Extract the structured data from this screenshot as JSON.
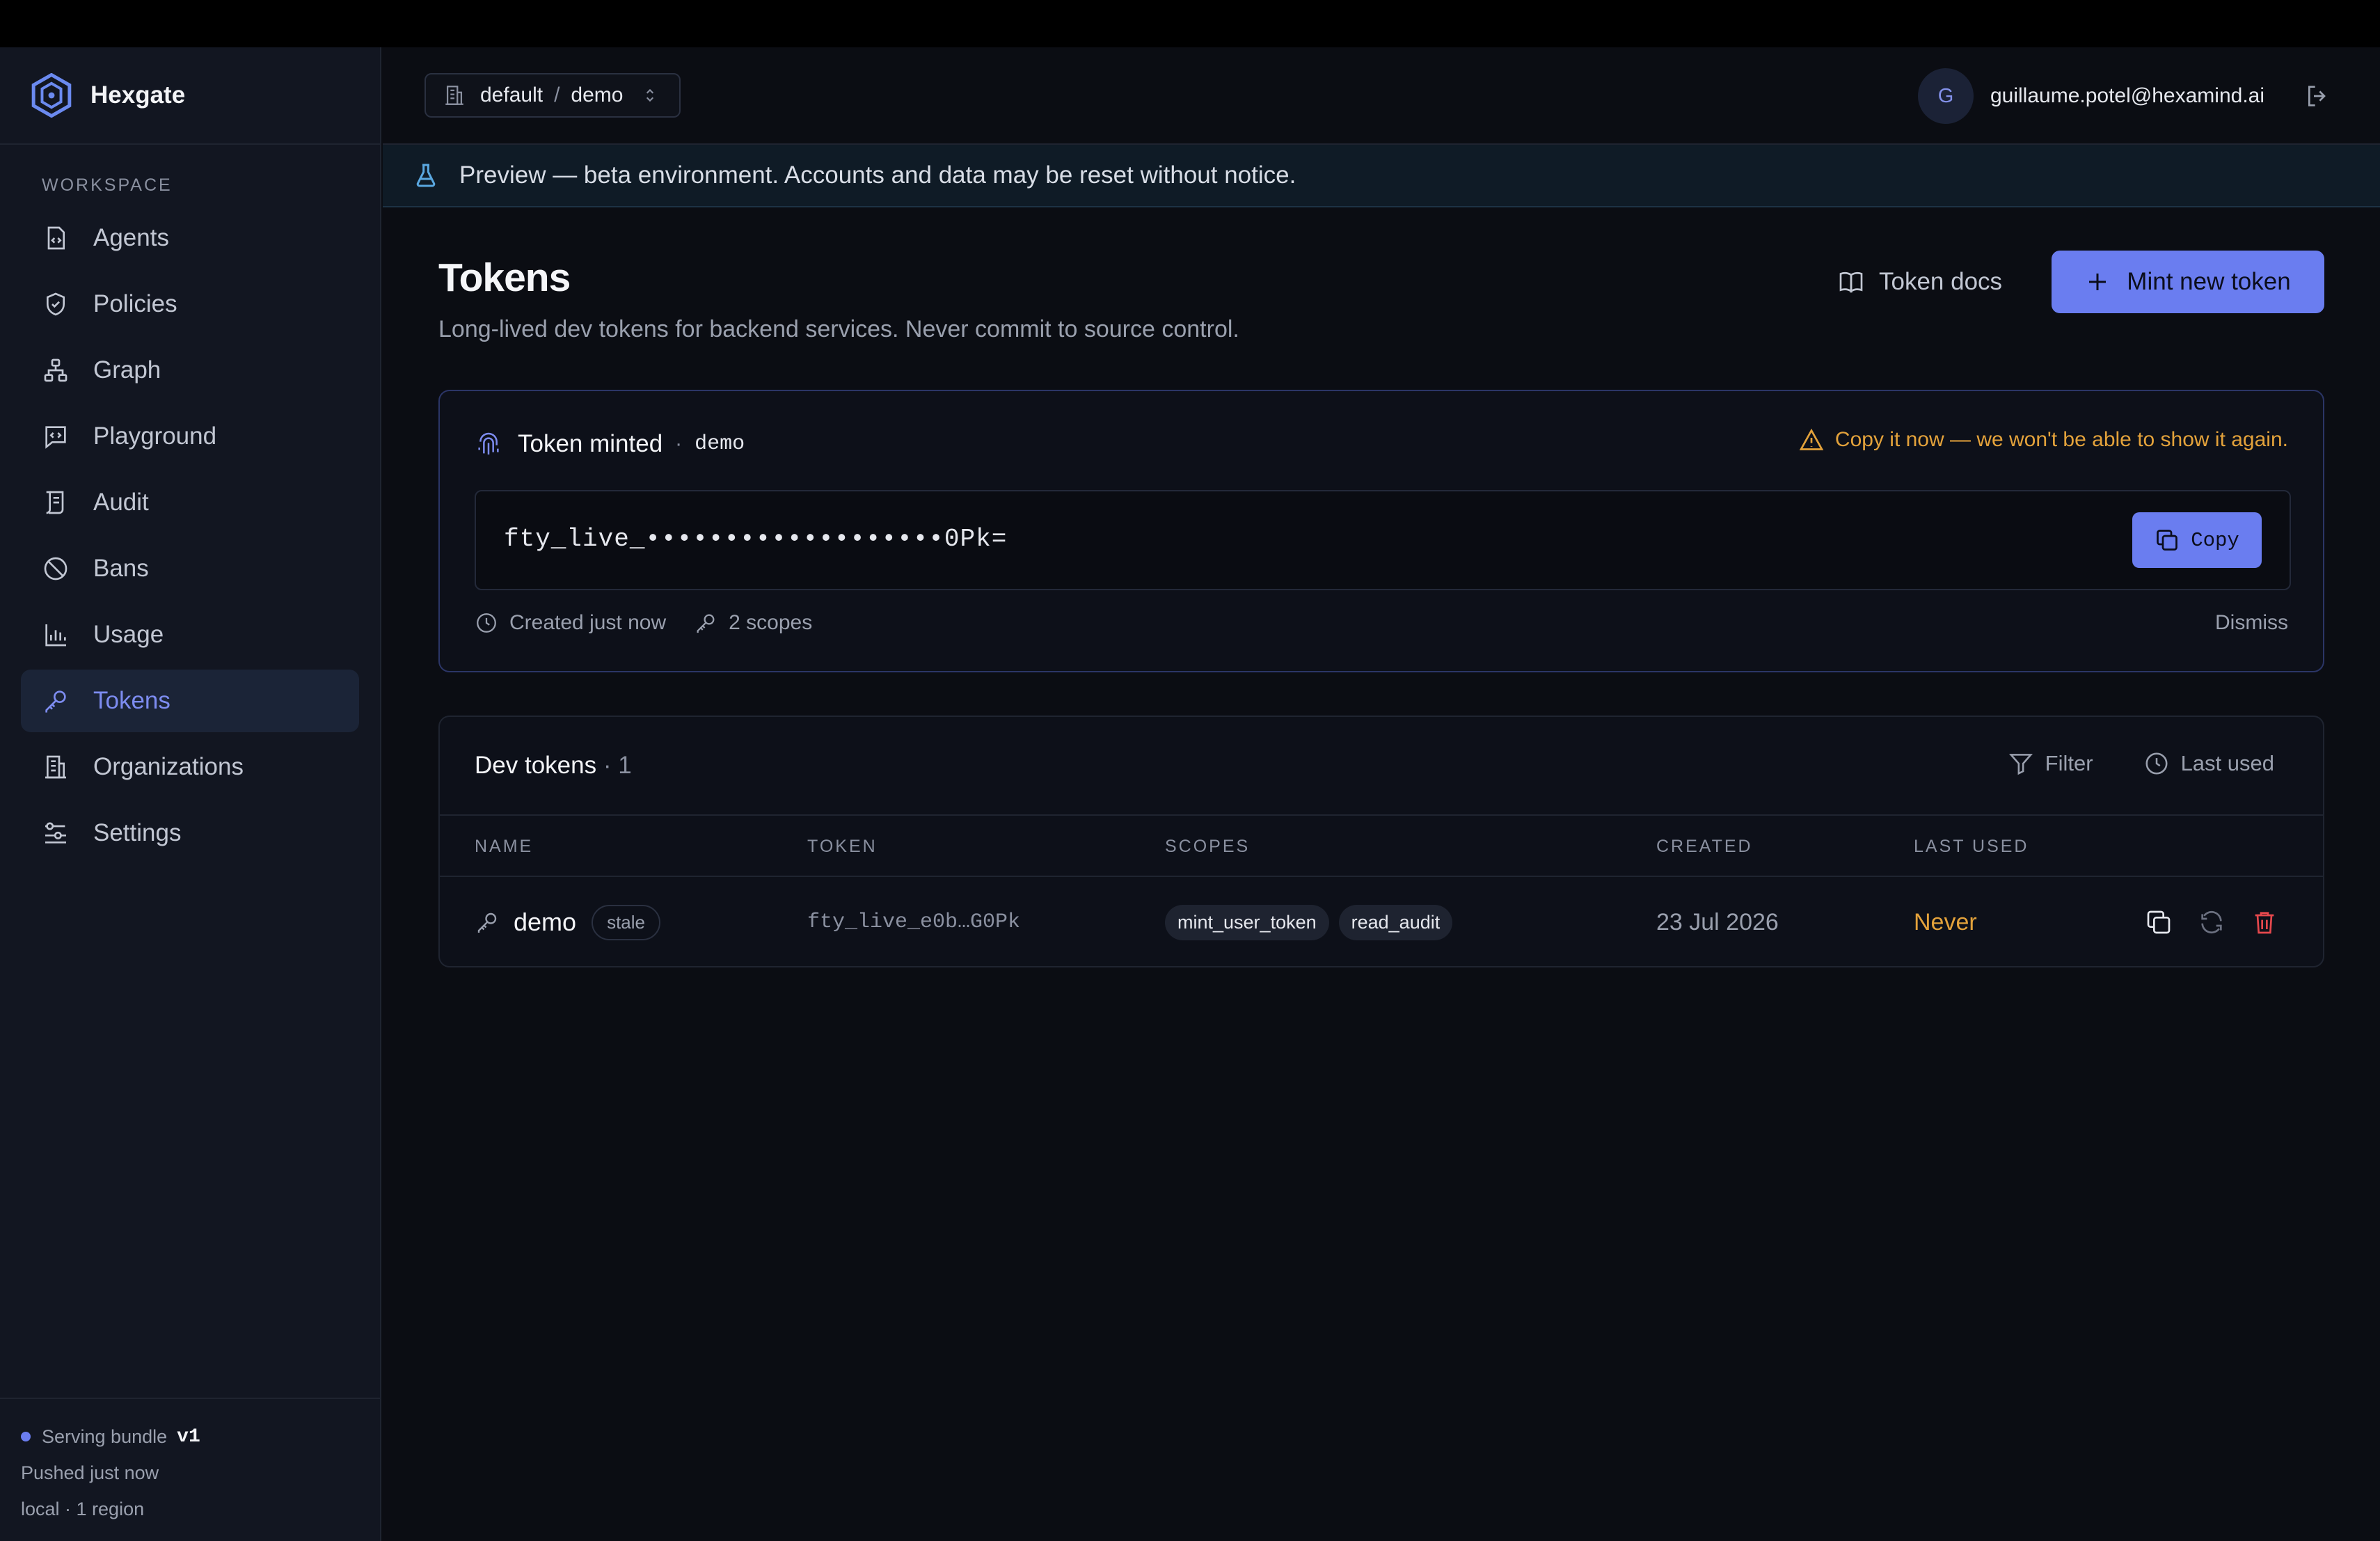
{
  "app": {
    "name": "Hexgate"
  },
  "sidebar": {
    "section_label": "WORKSPACE",
    "items": [
      {
        "label": "Agents",
        "icon": "agents-icon"
      },
      {
        "label": "Policies",
        "icon": "shield-icon"
      },
      {
        "label": "Graph",
        "icon": "graph-icon"
      },
      {
        "label": "Playground",
        "icon": "playground-icon"
      },
      {
        "label": "Audit",
        "icon": "audit-icon"
      },
      {
        "label": "Bans",
        "icon": "ban-icon"
      },
      {
        "label": "Usage",
        "icon": "chart-icon"
      },
      {
        "label": "Tokens",
        "icon": "key-icon",
        "active": true
      },
      {
        "label": "Organizations",
        "icon": "building-icon"
      },
      {
        "label": "Settings",
        "icon": "sliders-icon"
      }
    ],
    "footer": {
      "bundle_label": "Serving bundle",
      "bundle_version": "v1",
      "pushed": "Pushed just now",
      "region": "local · 1 region"
    }
  },
  "header": {
    "org": "default",
    "separator": "/",
    "project": "demo",
    "user_initial": "G",
    "user_email": "guillaume.potel@hexamind.ai"
  },
  "banner": {
    "text": "Preview — beta environment. Accounts and data may be reset without notice."
  },
  "page": {
    "title": "Tokens",
    "subtitle": "Long-lived dev tokens for backend services. Never commit to source control.",
    "docs_label": "Token docs",
    "mint_label": "Mint new token"
  },
  "minted": {
    "title": "Token minted",
    "dot": "·",
    "name": "demo",
    "warning": "Copy it now — we won't be able to show it again.",
    "secret": "fty_live_•••••••••••••••••••0Pk=",
    "copy_label": "Copy",
    "created": "Created just now",
    "scopes": "2 scopes",
    "dismiss": "Dismiss"
  },
  "tokens_table": {
    "title": "Dev tokens",
    "count": "· 1",
    "filter_label": "Filter",
    "sort_label": "Last used",
    "columns": [
      "NAME",
      "TOKEN",
      "SCOPES",
      "CREATED",
      "LAST USED"
    ],
    "rows": [
      {
        "name": "demo",
        "badge": "stale",
        "token": "fty_live_e0b…G0Pk",
        "scopes": [
          "mint_user_token",
          "read_audit"
        ],
        "created": "23 Jul 2026",
        "last_used": "Never"
      }
    ]
  },
  "colors": {
    "accent": "#6a7df0",
    "warning": "#e3a23b",
    "danger": "#e5484d",
    "background": "#0b0d13",
    "sidebar": "#121621"
  }
}
